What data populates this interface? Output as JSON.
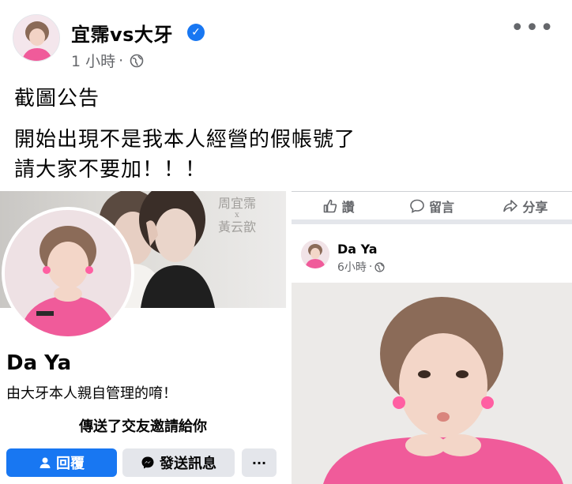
{
  "post": {
    "author": "宜霈vs大牙",
    "verified_icon": "verified-badge-icon",
    "time": "1 小時",
    "separator": "·",
    "audience_icon": "globe-icon",
    "more_label": "•••",
    "text_line1": "截圖公告",
    "text_line2": "開始出現不是我本人經營的假帳號了\n請大家不要加！！！"
  },
  "profile_screenshot": {
    "cover_caption_top": "周宜霈",
    "cover_caption_x": "x",
    "cover_caption_bottom": "黃云歆",
    "name": "Da Ya",
    "bio": "由大牙本人親自管理的唷！",
    "friend_request": "傳送了交友邀請給你",
    "reply_label": "回覆",
    "message_label": "發送訊息",
    "more_label": "···"
  },
  "feed_screenshot": {
    "actions": {
      "like": "讚",
      "comment": "留言",
      "share": "分享"
    },
    "name": "Da Ya",
    "time": "6小時",
    "separator": "·"
  },
  "colors": {
    "brand_blue": "#1877f2",
    "secondary_text": "#65676b",
    "button_gray": "#e4e6eb",
    "pink_outfit": "#f05b9a"
  }
}
